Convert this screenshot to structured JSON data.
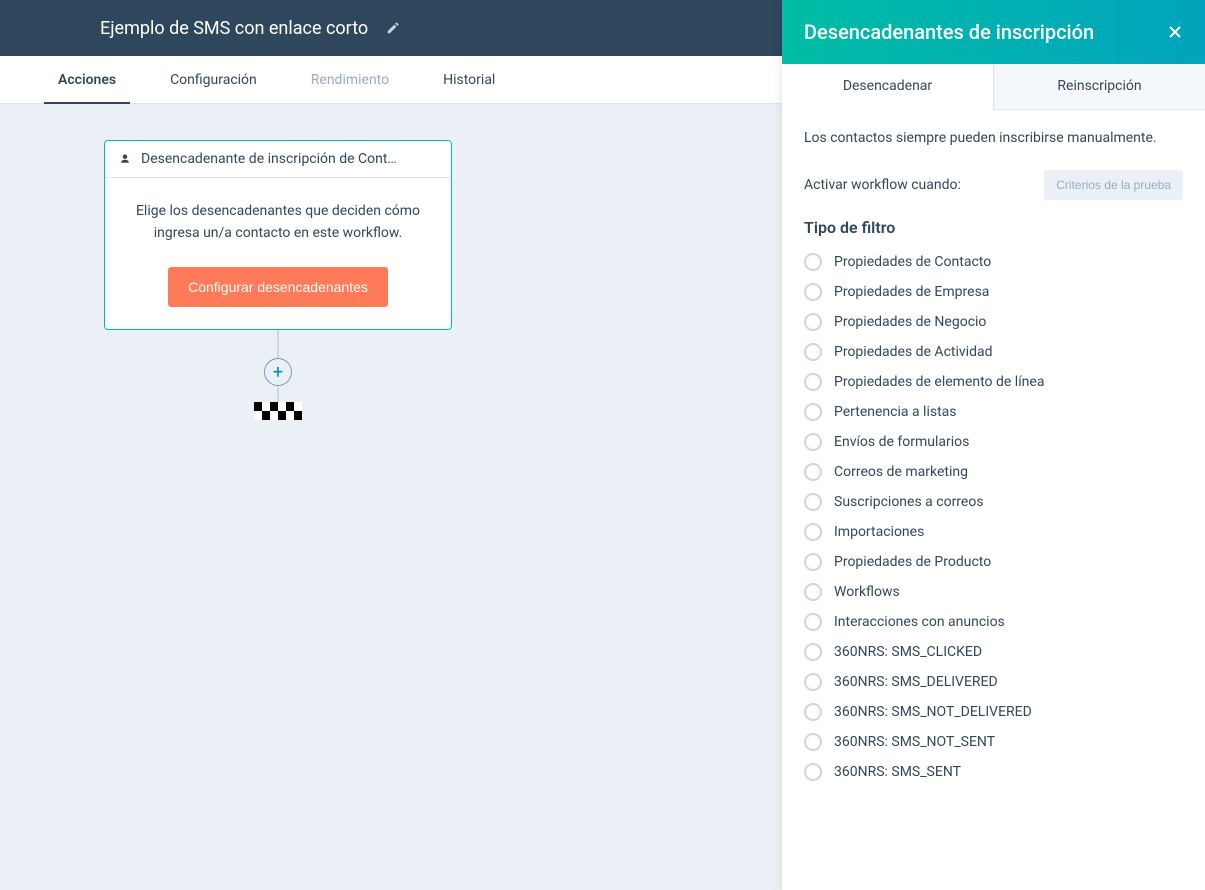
{
  "header": {
    "title": "Ejemplo de SMS con enlace corto"
  },
  "nav": {
    "tabs": [
      {
        "label": "Acciones",
        "active": true,
        "disabled": false
      },
      {
        "label": "Configuración",
        "active": false,
        "disabled": false
      },
      {
        "label": "Rendimiento",
        "active": false,
        "disabled": true
      },
      {
        "label": "Historial",
        "active": false,
        "disabled": false
      }
    ]
  },
  "triggerCard": {
    "title": "Desencadenante de inscripción de Cont…",
    "body": "Elige los desencadenantes que deciden cómo ingresa un/a contacto en este workflow.",
    "button": "Configurar desencadenantes"
  },
  "addButton": "+",
  "panel": {
    "title": "Desencadenantes de inscripción",
    "tabs": [
      {
        "label": "Desencadenar",
        "active": true
      },
      {
        "label": "Reinscripción",
        "active": false
      }
    ],
    "info": "Los contactos siempre pueden inscribirse manualmente.",
    "activateLabel": "Activar workflow cuando:",
    "testButton": "Criterios de la prueba",
    "filterTitle": "Tipo de filtro",
    "filters": [
      "Propiedades de Contacto",
      "Propiedades de Empresa",
      "Propiedades de Negocio",
      "Propiedades de Actividad",
      "Propiedades de elemento de línea",
      "Pertenencia a listas",
      "Envíos de formularios",
      "Correos de marketing",
      "Suscripciones a correos",
      "Importaciones",
      "Propiedades de Producto",
      "Workflows",
      "Interacciones con anuncios",
      "360NRS: SMS_CLICKED",
      "360NRS: SMS_DELIVERED",
      "360NRS: SMS_NOT_DELIVERED",
      "360NRS: SMS_NOT_SENT",
      "360NRS: SMS_SENT"
    ]
  }
}
